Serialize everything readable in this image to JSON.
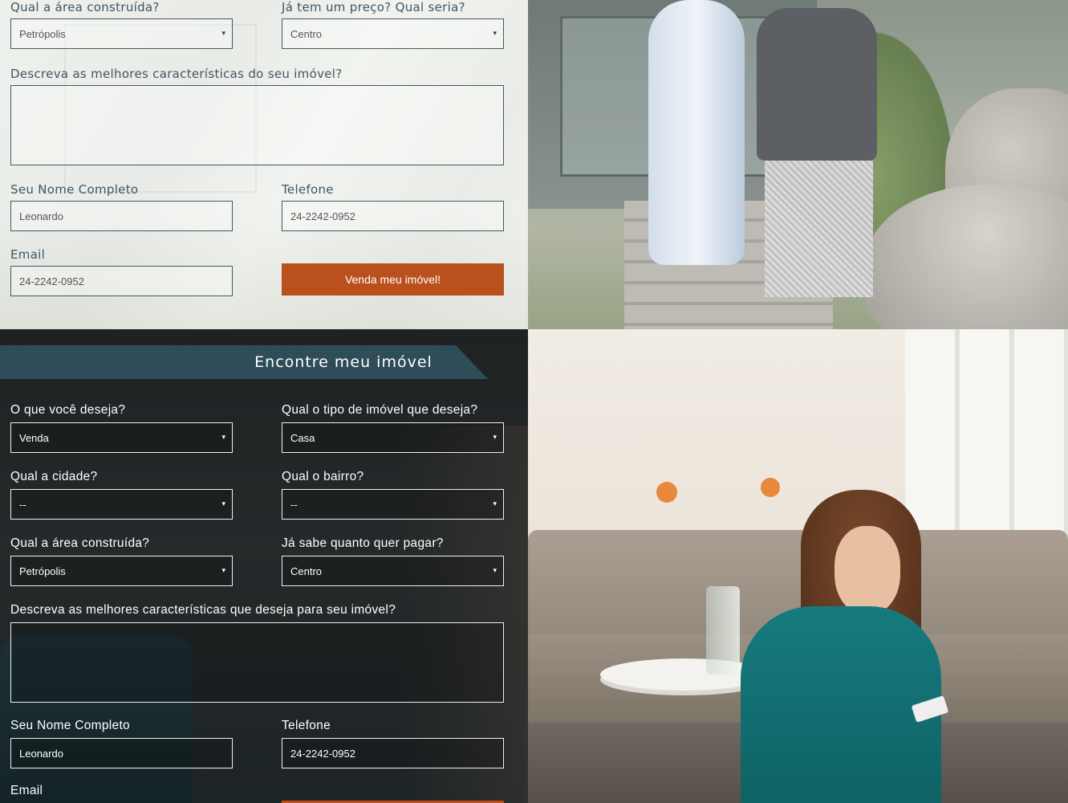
{
  "sell_form": {
    "area_label": "Qual a área construída?",
    "area_value": "Petrópolis",
    "price_label": "Já tem um preço? Qual seria?",
    "price_value": "Centro",
    "description_label": "Descreva as melhores características do seu imóvel?",
    "description_value": "",
    "name_label": "Seu Nome Completo",
    "name_value": "Leonardo",
    "phone_label": "Telefone",
    "phone_value": "24-2242-0952",
    "email_label": "Email",
    "email_value": "24-2242-0952",
    "submit_label": "Venda meu imóvel!"
  },
  "find_form": {
    "title": "Encontre meu imóvel",
    "want_label": "O que você deseja?",
    "want_value": "Venda",
    "type_label": "Qual o tipo de imóvel que deseja?",
    "type_value": "Casa",
    "city_label": "Qual a cidade?",
    "city_value": "--",
    "neighborhood_label": "Qual o bairro?",
    "neighborhood_value": "--",
    "area_label": "Qual a área construída?",
    "area_value": "Petrópolis",
    "budget_label": "Já sabe quanto quer pagar?",
    "budget_value": "Centro",
    "description_label": "Descreva as melhores características que deseja para seu imóvel?",
    "description_value": "",
    "name_label": "Seu Nome Completo",
    "name_value": "Leonardo",
    "phone_label": "Telefone",
    "phone_value": "24-2242-0952",
    "email_label": "Email"
  },
  "icons": {
    "select_caret": "▾"
  },
  "colors": {
    "accent_button": "#b9501e",
    "ribbon": "#2f4d58",
    "field_border_light": "#3e5a6a"
  }
}
